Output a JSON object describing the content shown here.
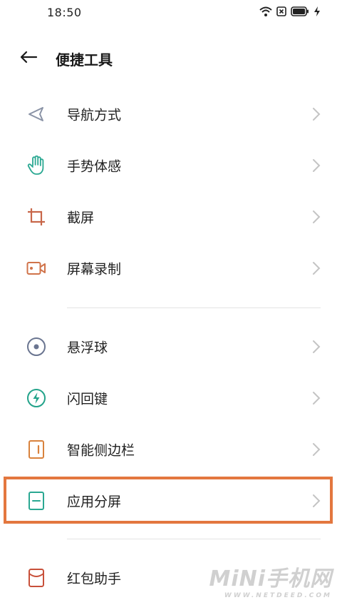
{
  "status_bar": {
    "time": "18:50",
    "icons": [
      "wifi-icon",
      "sim-none-icon",
      "battery-icon",
      "charging-icon"
    ]
  },
  "header": {
    "back_icon": "arrow-left-icon",
    "title": "便捷工具"
  },
  "menu": {
    "items": [
      {
        "label": "导航方式",
        "icon": "navigation-triangle-icon",
        "color": "#8a93a6"
      },
      {
        "label": "手势体感",
        "icon": "hand-gesture-icon",
        "color": "#2aa892"
      },
      {
        "label": "截屏",
        "icon": "crop-icon",
        "color": "#c8674a"
      },
      {
        "label": "屏幕录制",
        "icon": "video-record-icon",
        "color": "#d0734a"
      },
      {
        "label": "悬浮球",
        "icon": "floating-ball-icon",
        "color": "#6a7590"
      },
      {
        "label": "闪回键",
        "icon": "flashback-bolt-icon",
        "color": "#23a38a"
      },
      {
        "label": "智能侧边栏",
        "icon": "smart-sidebar-icon",
        "color": "#d9823d"
      },
      {
        "label": "应用分屏",
        "icon": "split-screen-icon",
        "color": "#2aa892"
      },
      {
        "label": "红包助手",
        "icon": "red-envelope-icon",
        "color": "#c8503a"
      }
    ]
  },
  "highlight_color": "#e3773f",
  "watermark": {
    "main": "MiNi手机网",
    "sub": "WWW.NETDEED.COM"
  }
}
